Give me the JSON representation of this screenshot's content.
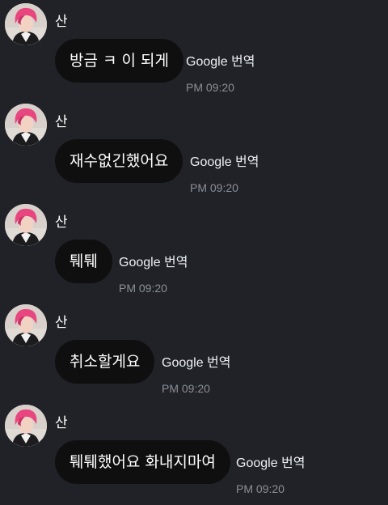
{
  "messages": [
    {
      "sender": "산",
      "text": "방금 ㅋ 이 되게",
      "translate": "Google 번역",
      "time": "PM 09:20"
    },
    {
      "sender": "산",
      "text": "재수없긴했어요",
      "translate": "Google 번역",
      "time": "PM 09:20"
    },
    {
      "sender": "산",
      "text": "퉤퉤",
      "translate": "Google 번역",
      "time": "PM 09:20"
    },
    {
      "sender": "산",
      "text": "취소할게요",
      "translate": "Google 번역",
      "time": "PM 09:20"
    },
    {
      "sender": "산",
      "text": "퉤퉤했어요 화내지마여",
      "translate": "Google 번역",
      "time": "PM 09:20"
    }
  ],
  "icons": {
    "avatar": "avatar-photo-icon"
  },
  "colors": {
    "background": "#202227",
    "bubble": "#0f0f10",
    "text": "#ffffff",
    "time": "#8b8f96",
    "avatar_hair": "#e8467f"
  }
}
